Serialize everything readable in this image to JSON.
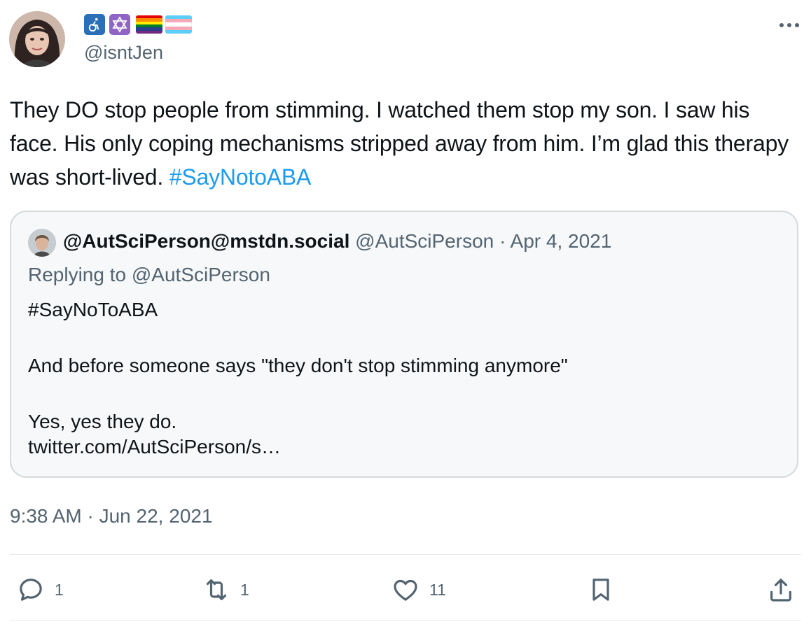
{
  "author": {
    "handle": "@isntJen",
    "badges": [
      "wheelchair-icon",
      "star-of-david-icon",
      "rainbow-flag-icon",
      "transgender-flag-icon"
    ]
  },
  "tweet": {
    "text": "They DO stop people from stimming. I watched them stop my son. I saw his face. His only coping mechanisms stripped away from him. I’m glad this therapy was short-lived. ",
    "hashtag": "#SayNotoABA",
    "timestamp": "9:38 AM · Jun 22, 2021"
  },
  "quoted": {
    "name": "@AutSciPerson@mstdn.social",
    "meta": " @AutSciPerson · Apr 4, 2021",
    "replying_to": "Replying to @AutSciPerson",
    "lines": [
      "#SayNoToABA",
      "",
      "And before someone says \"they don't stop stimming anymore\"",
      "",
      "Yes, yes they do.",
      "twitter.com/AutSciPerson/s…"
    ]
  },
  "actions": {
    "replies": "1",
    "retweets": "1",
    "likes": "11"
  },
  "colors": {
    "link": "#1d9bf0",
    "muted": "#536471",
    "text": "#0f1419"
  }
}
